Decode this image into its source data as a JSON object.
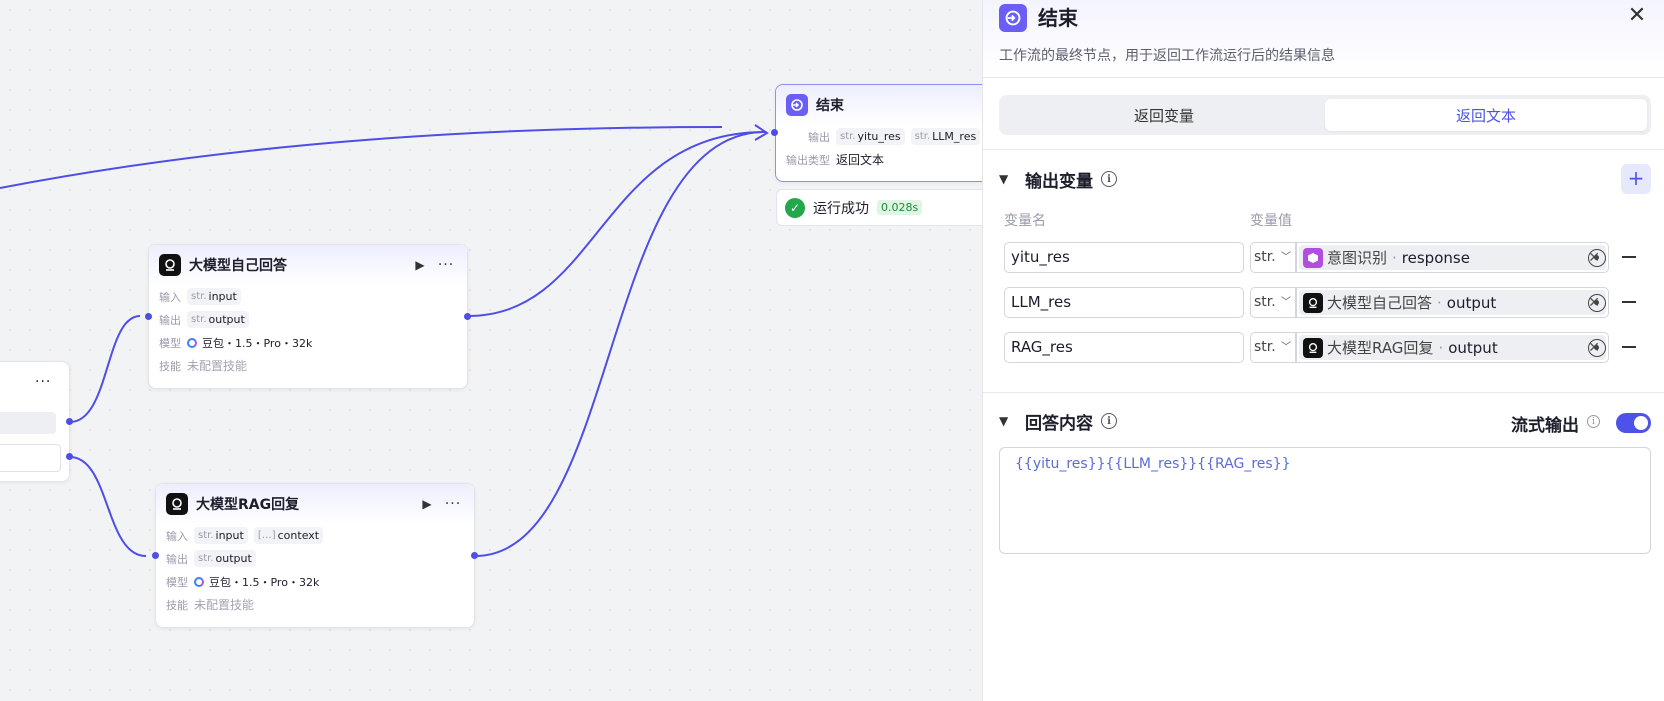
{
  "canvas": {
    "nodes": {
      "llm_self": {
        "title": "大模型自己回答",
        "input_label": "输入",
        "output_label": "输出",
        "model_label": "模型",
        "skills_label": "技能",
        "inputs": [
          {
            "type": "str.",
            "name": "input"
          }
        ],
        "outputs": [
          {
            "type": "str.",
            "name": "output"
          }
        ],
        "model": "豆包・1.5・Pro・32k",
        "skills": "未配置技能"
      },
      "llm_rag": {
        "title": "大模型RAG回复",
        "input_label": "输入",
        "output_label": "输出",
        "model_label": "模型",
        "skills_label": "技能",
        "inputs": [
          {
            "type": "str.",
            "name": "input"
          },
          {
            "type": "[…]",
            "name": "context"
          }
        ],
        "outputs": [
          {
            "type": "str.",
            "name": "output"
          }
        ],
        "model": "豆包・1.5・Pro・32k",
        "skills": "未配置技能"
      },
      "end": {
        "title": "结束",
        "output_label": "输出",
        "output_type_label": "输出类型",
        "outputs": [
          {
            "type": "str.",
            "name": "yitu_res"
          },
          {
            "type": "str.",
            "name": "LLM_res"
          },
          {
            "type": "str.",
            "name": ""
          }
        ],
        "output_type": "返回文本"
      },
      "partial_left": {
        "more": "···"
      }
    },
    "run_status": {
      "label": "运行成功",
      "time": "0.028s"
    },
    "edge_color": "#4e4ee6"
  },
  "panel": {
    "title": "结束",
    "description": "工作流的最终节点，用于返回工作流运行后的结果信息",
    "tabs": [
      "返回变量",
      "返回文本"
    ],
    "active_tab": "返回文本",
    "output_section": {
      "title": "输出变量",
      "col_name": "变量名",
      "col_value": "变量值",
      "rows": [
        {
          "name": "yitu_res",
          "type": "str.",
          "ref_node": "意图识别",
          "ref_field": "response",
          "icon": "intent-icon"
        },
        {
          "name": "LLM_res",
          "type": "str.",
          "ref_node": "大模型自己回答",
          "ref_field": "output",
          "icon": "llm-icon"
        },
        {
          "name": "RAG_res",
          "type": "str.",
          "ref_node": "大模型RAG回复",
          "ref_field": "output",
          "icon": "llm-icon"
        }
      ]
    },
    "answer_section": {
      "title": "回答内容",
      "stream_label": "流式输出",
      "stream_enabled": true,
      "content": "{{yitu_res}}{{LLM_res}}{{RAG_res}}"
    },
    "accent_color": "#4d53e8"
  }
}
